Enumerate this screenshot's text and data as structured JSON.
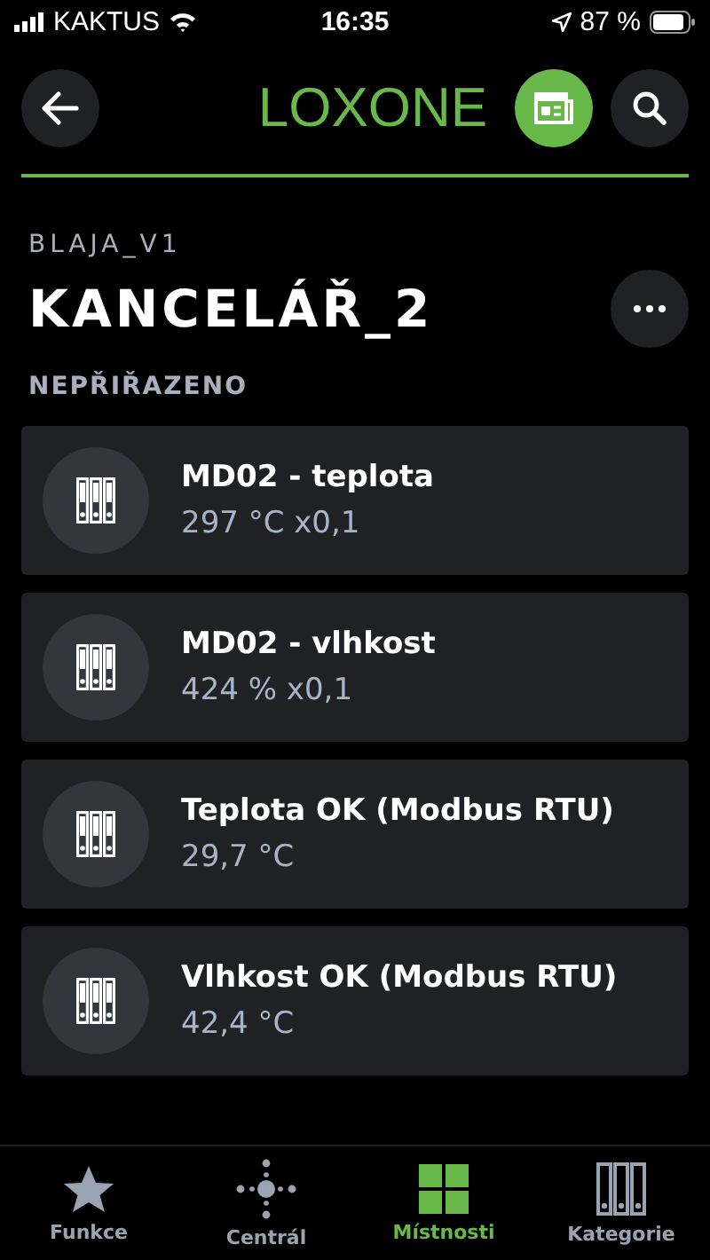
{
  "status_bar": {
    "carrier": "KAKTUS",
    "time": "16:35",
    "battery": "87 %"
  },
  "header": {
    "logo": "LOXONE"
  },
  "breadcrumb": "BLAJA_V1",
  "title": "KANCELÁŘ_2",
  "section": "NEPŘIŘAZENO",
  "items": [
    {
      "name": "MD02 - teplota",
      "value": "297 °C x0,1"
    },
    {
      "name": "MD02 - vlhkost",
      "value": "424 % x0,1"
    },
    {
      "name": "Teplota OK (Modbus RTU)",
      "value": "29,7 °C"
    },
    {
      "name": "Vlhkost OK (Modbus RTU)",
      "value": "42,4 °C"
    }
  ],
  "tabs": [
    {
      "label": "Funkce",
      "kind": "star",
      "selected": false
    },
    {
      "label": "Centrál",
      "kind": "central",
      "selected": false
    },
    {
      "label": "Místnosti",
      "kind": "grid",
      "selected": true
    },
    {
      "label": "Kategorie",
      "kind": "binders",
      "selected": false
    }
  ]
}
